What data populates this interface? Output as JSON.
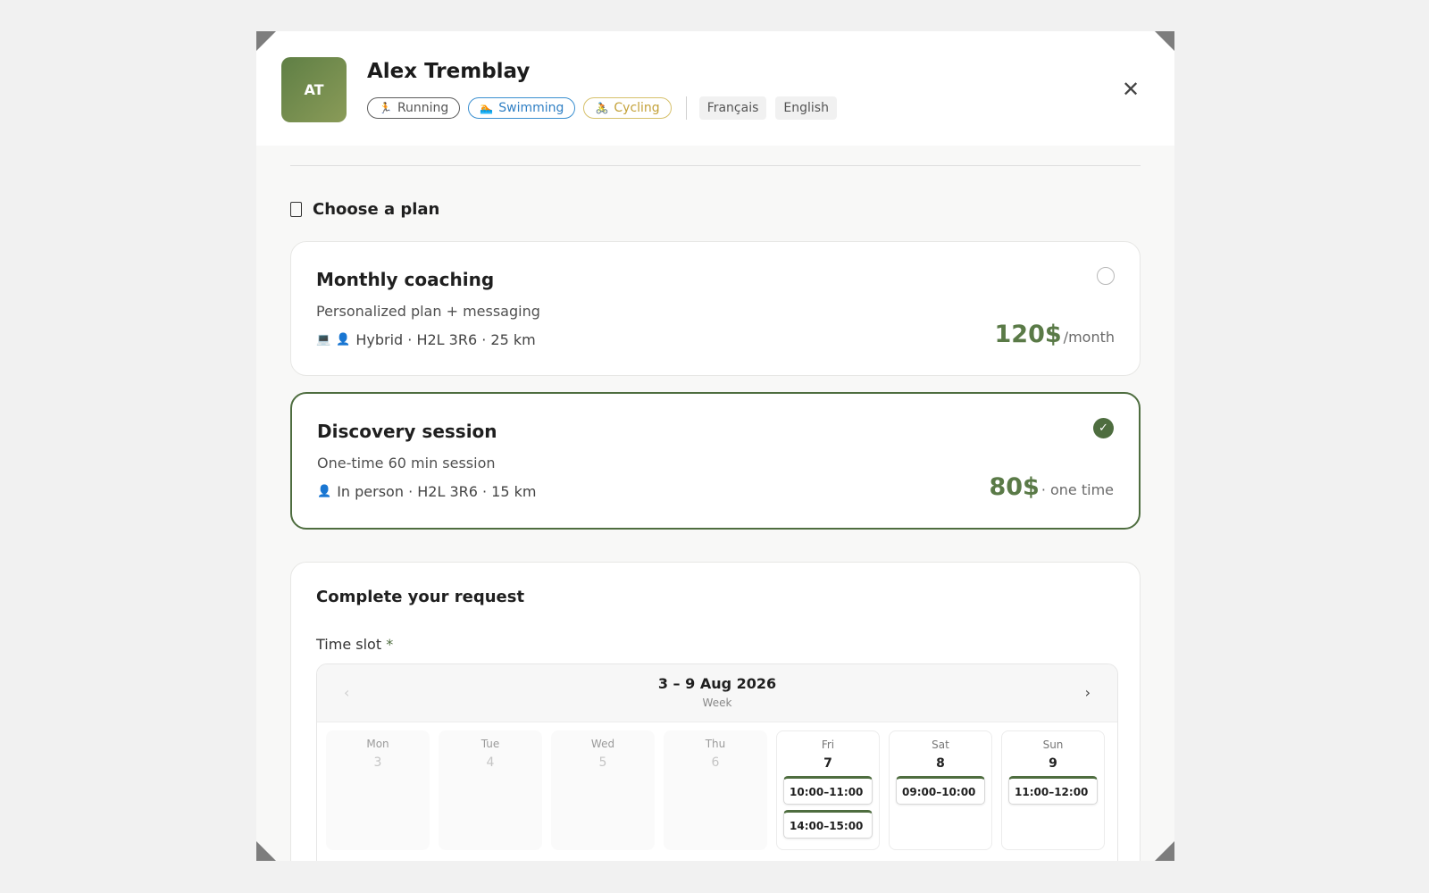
{
  "coach": {
    "initials": "AT",
    "name": "Alex Tremblay",
    "sports": [
      {
        "label": "Running",
        "icon": "running-icon"
      },
      {
        "label": "Swimming",
        "icon": "swimming-icon"
      },
      {
        "label": "Cycling",
        "icon": "cycling-icon"
      }
    ],
    "languages": [
      "Français",
      "English"
    ]
  },
  "plans": {
    "title": "Choose a plan",
    "items": [
      {
        "name": "Monthly coaching",
        "description": "Personalized plan + messaging",
        "details": "Hybrid · H2L 3R6 · 25 km",
        "price": "120$",
        "unit": "/month",
        "selected": false
      },
      {
        "name": "Discovery session",
        "description": "One-time 60 min session",
        "details": "In person · H2L 3R6 · 15 km",
        "price": "80$",
        "unit": " · one time",
        "selected": true
      }
    ]
  },
  "request": {
    "title": "Complete your request",
    "time_slot_label": "Time slot",
    "required_marker": "*",
    "calendar": {
      "range": "3 – 9 Aug 2026",
      "view": "Week",
      "prev": "‹",
      "next": "›",
      "days": [
        {
          "name": "Mon",
          "date": "3",
          "available": false,
          "slots": []
        },
        {
          "name": "Tue",
          "date": "4",
          "available": false,
          "slots": []
        },
        {
          "name": "Wed",
          "date": "5",
          "available": false,
          "slots": []
        },
        {
          "name": "Thu",
          "date": "6",
          "available": false,
          "slots": []
        },
        {
          "name": "Fri",
          "date": "7",
          "available": true,
          "slots": [
            "10:00–11:00",
            "14:00–15:00"
          ]
        },
        {
          "name": "Sat",
          "date": "8",
          "available": true,
          "slots": [
            "09:00–10:00"
          ]
        },
        {
          "name": "Sun",
          "date": "9",
          "available": true,
          "slots": [
            "11:00–12:00"
          ]
        }
      ]
    }
  },
  "colors": {
    "accent": "#4e6d3f",
    "swimming": "#3a8fd0",
    "cycling": "#d6c06a"
  }
}
